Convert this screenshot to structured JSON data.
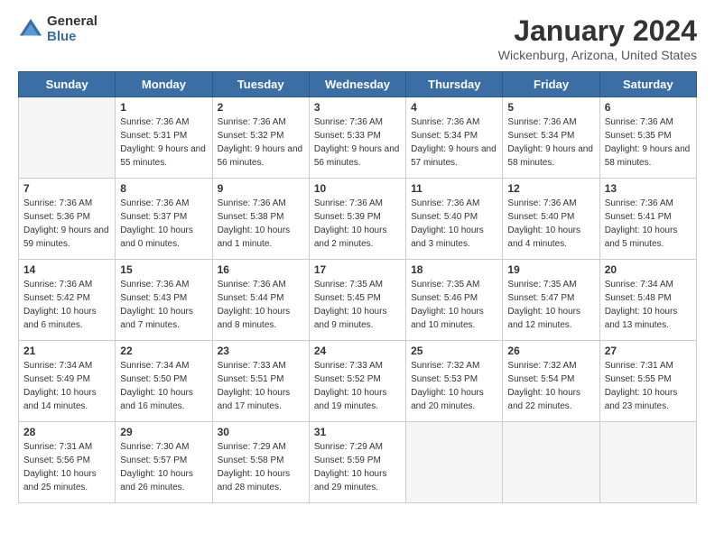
{
  "header": {
    "logo_general": "General",
    "logo_blue": "Blue",
    "month_title": "January 2024",
    "location": "Wickenburg, Arizona, United States"
  },
  "days_of_week": [
    "Sunday",
    "Monday",
    "Tuesday",
    "Wednesday",
    "Thursday",
    "Friday",
    "Saturday"
  ],
  "weeks": [
    [
      {
        "day": "",
        "empty": true
      },
      {
        "day": "1",
        "sunrise": "7:36 AM",
        "sunset": "5:31 PM",
        "daylight": "9 hours and 55 minutes."
      },
      {
        "day": "2",
        "sunrise": "7:36 AM",
        "sunset": "5:32 PM",
        "daylight": "9 hours and 56 minutes."
      },
      {
        "day": "3",
        "sunrise": "7:36 AM",
        "sunset": "5:33 PM",
        "daylight": "9 hours and 56 minutes."
      },
      {
        "day": "4",
        "sunrise": "7:36 AM",
        "sunset": "5:34 PM",
        "daylight": "9 hours and 57 minutes."
      },
      {
        "day": "5",
        "sunrise": "7:36 AM",
        "sunset": "5:34 PM",
        "daylight": "9 hours and 58 minutes."
      },
      {
        "day": "6",
        "sunrise": "7:36 AM",
        "sunset": "5:35 PM",
        "daylight": "9 hours and 58 minutes."
      }
    ],
    [
      {
        "day": "7",
        "sunrise": "7:36 AM",
        "sunset": "5:36 PM",
        "daylight": "9 hours and 59 minutes."
      },
      {
        "day": "8",
        "sunrise": "7:36 AM",
        "sunset": "5:37 PM",
        "daylight": "10 hours and 0 minutes."
      },
      {
        "day": "9",
        "sunrise": "7:36 AM",
        "sunset": "5:38 PM",
        "daylight": "10 hours and 1 minute."
      },
      {
        "day": "10",
        "sunrise": "7:36 AM",
        "sunset": "5:39 PM",
        "daylight": "10 hours and 2 minutes."
      },
      {
        "day": "11",
        "sunrise": "7:36 AM",
        "sunset": "5:40 PM",
        "daylight": "10 hours and 3 minutes."
      },
      {
        "day": "12",
        "sunrise": "7:36 AM",
        "sunset": "5:40 PM",
        "daylight": "10 hours and 4 minutes."
      },
      {
        "day": "13",
        "sunrise": "7:36 AM",
        "sunset": "5:41 PM",
        "daylight": "10 hours and 5 minutes."
      }
    ],
    [
      {
        "day": "14",
        "sunrise": "7:36 AM",
        "sunset": "5:42 PM",
        "daylight": "10 hours and 6 minutes."
      },
      {
        "day": "15",
        "sunrise": "7:36 AM",
        "sunset": "5:43 PM",
        "daylight": "10 hours and 7 minutes."
      },
      {
        "day": "16",
        "sunrise": "7:36 AM",
        "sunset": "5:44 PM",
        "daylight": "10 hours and 8 minutes."
      },
      {
        "day": "17",
        "sunrise": "7:35 AM",
        "sunset": "5:45 PM",
        "daylight": "10 hours and 9 minutes."
      },
      {
        "day": "18",
        "sunrise": "7:35 AM",
        "sunset": "5:46 PM",
        "daylight": "10 hours and 10 minutes."
      },
      {
        "day": "19",
        "sunrise": "7:35 AM",
        "sunset": "5:47 PM",
        "daylight": "10 hours and 12 minutes."
      },
      {
        "day": "20",
        "sunrise": "7:34 AM",
        "sunset": "5:48 PM",
        "daylight": "10 hours and 13 minutes."
      }
    ],
    [
      {
        "day": "21",
        "sunrise": "7:34 AM",
        "sunset": "5:49 PM",
        "daylight": "10 hours and 14 minutes."
      },
      {
        "day": "22",
        "sunrise": "7:34 AM",
        "sunset": "5:50 PM",
        "daylight": "10 hours and 16 minutes."
      },
      {
        "day": "23",
        "sunrise": "7:33 AM",
        "sunset": "5:51 PM",
        "daylight": "10 hours and 17 minutes."
      },
      {
        "day": "24",
        "sunrise": "7:33 AM",
        "sunset": "5:52 PM",
        "daylight": "10 hours and 19 minutes."
      },
      {
        "day": "25",
        "sunrise": "7:32 AM",
        "sunset": "5:53 PM",
        "daylight": "10 hours and 20 minutes."
      },
      {
        "day": "26",
        "sunrise": "7:32 AM",
        "sunset": "5:54 PM",
        "daylight": "10 hours and 22 minutes."
      },
      {
        "day": "27",
        "sunrise": "7:31 AM",
        "sunset": "5:55 PM",
        "daylight": "10 hours and 23 minutes."
      }
    ],
    [
      {
        "day": "28",
        "sunrise": "7:31 AM",
        "sunset": "5:56 PM",
        "daylight": "10 hours and 25 minutes."
      },
      {
        "day": "29",
        "sunrise": "7:30 AM",
        "sunset": "5:57 PM",
        "daylight": "10 hours and 26 minutes."
      },
      {
        "day": "30",
        "sunrise": "7:29 AM",
        "sunset": "5:58 PM",
        "daylight": "10 hours and 28 minutes."
      },
      {
        "day": "31",
        "sunrise": "7:29 AM",
        "sunset": "5:59 PM",
        "daylight": "10 hours and 29 minutes."
      },
      {
        "day": "",
        "empty": true
      },
      {
        "day": "",
        "empty": true
      },
      {
        "day": "",
        "empty": true
      }
    ]
  ]
}
